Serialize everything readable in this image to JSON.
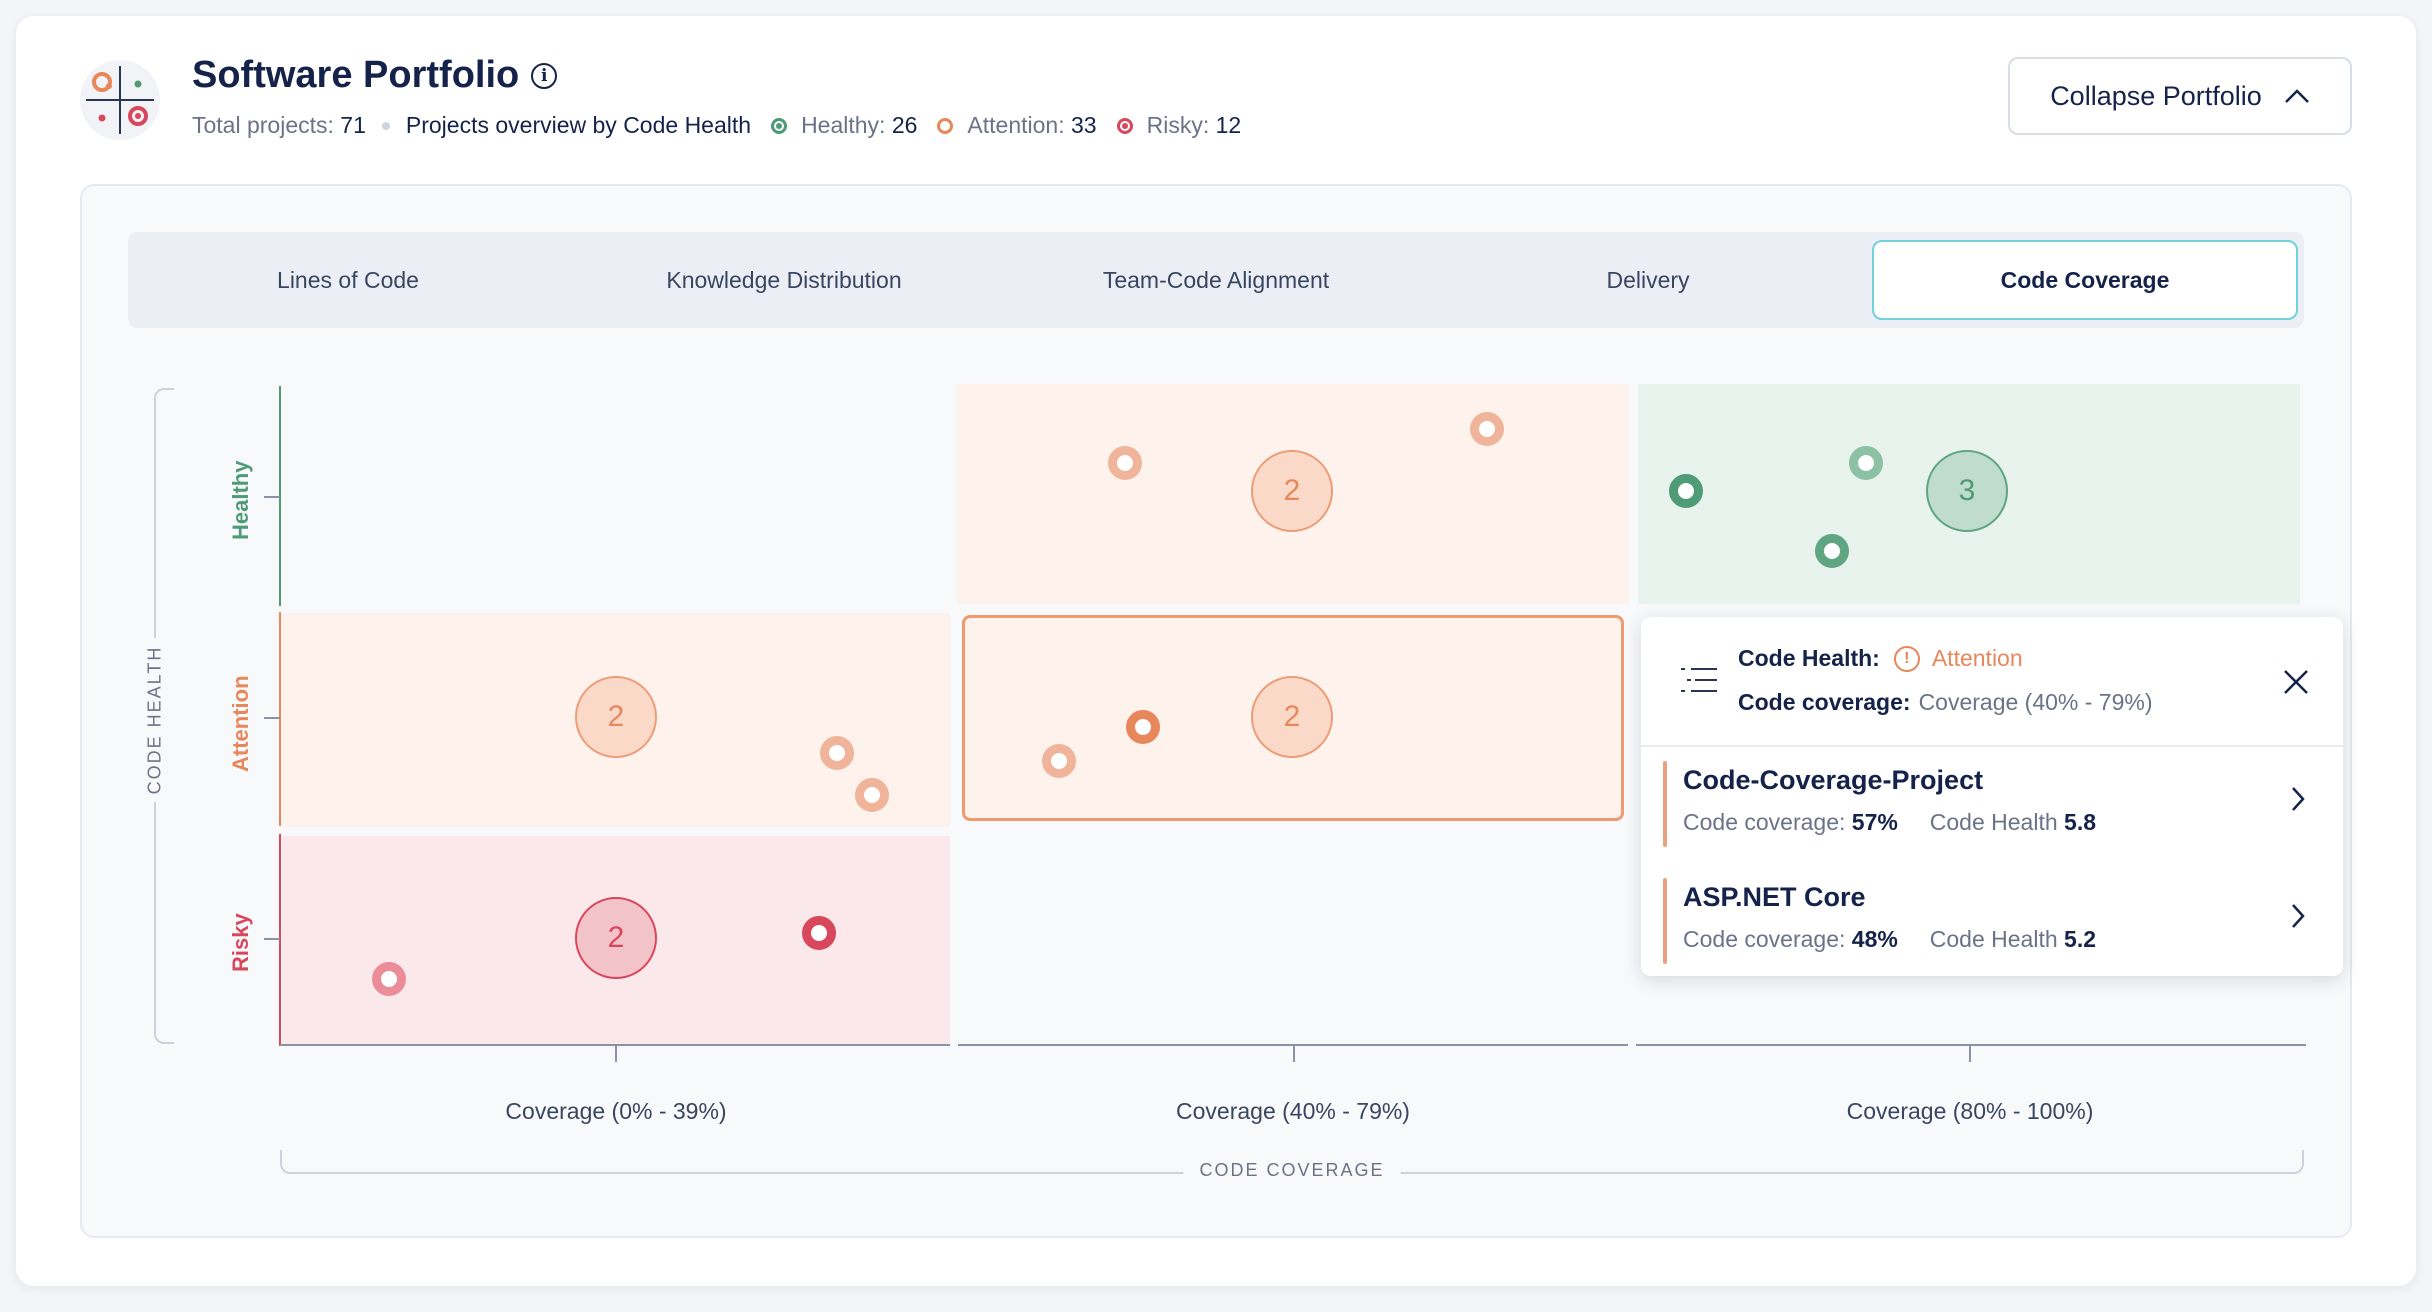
{
  "header": {
    "title": "Software Portfolio",
    "total_label": "Total projects:",
    "total_value": "71",
    "overview_label": "Projects overview by Code Health",
    "healthy_label": "Healthy:",
    "healthy_value": "26",
    "attention_label": "Attention:",
    "attention_value": "33",
    "risky_label": "Risky:",
    "risky_value": "12",
    "collapse_label": "Collapse Portfolio"
  },
  "colors": {
    "healthy": "#4f9b76",
    "attention": "#e8875a",
    "risky": "#d9475d",
    "accent_tab": "#6fd3d9"
  },
  "tabs": [
    {
      "label": "Lines of Code",
      "active": false
    },
    {
      "label": "Knowledge Distribution",
      "active": false
    },
    {
      "label": "Team-Code Alignment",
      "active": false
    },
    {
      "label": "Delivery",
      "active": false
    },
    {
      "label": "Code Coverage",
      "active": true
    }
  ],
  "chart_data": {
    "type": "scatter",
    "y_axis": {
      "title": "CODE HEALTH",
      "categories": [
        "Healthy",
        "Attention",
        "Risky"
      ]
    },
    "x_axis": {
      "title": "CODE COVERAGE",
      "categories": [
        "Coverage (0% - 39%)",
        "Coverage  (40% - 79%)",
        "Coverage (80% - 100%)"
      ]
    },
    "cells": [
      {
        "health": "Healthy",
        "coverage": "Coverage  (40% - 79%)",
        "projects": 4,
        "clusters": [
          2
        ]
      },
      {
        "health": "Healthy",
        "coverage": "Coverage (80% - 100%)",
        "projects": 6,
        "clusters": [
          3
        ]
      },
      {
        "health": "Attention",
        "coverage": "Coverage (0% - 39%)",
        "projects": 4,
        "clusters": [
          2
        ]
      },
      {
        "health": "Attention",
        "coverage": "Coverage  (40% - 79%)",
        "projects": 4,
        "clusters": [
          2
        ],
        "selected": true
      },
      {
        "health": "Risky",
        "coverage": "Coverage (0% - 39%)",
        "projects": 4,
        "clusters": [
          2
        ]
      }
    ]
  },
  "popup": {
    "health_label": "Code Health:",
    "health_value": "Attention",
    "coverage_label": "Code coverage:",
    "coverage_value": "Coverage (40% - 79%)",
    "projects": [
      {
        "name": "Code-Coverage-Project",
        "coverage_label": "Code coverage:",
        "coverage": "57%",
        "health_label": "Code Health",
        "health": "5.8"
      },
      {
        "name": "ASP.NET Core",
        "coverage_label": "Code coverage:",
        "coverage": "48%",
        "health_label": "Code Health",
        "health": "5.2"
      }
    ]
  }
}
